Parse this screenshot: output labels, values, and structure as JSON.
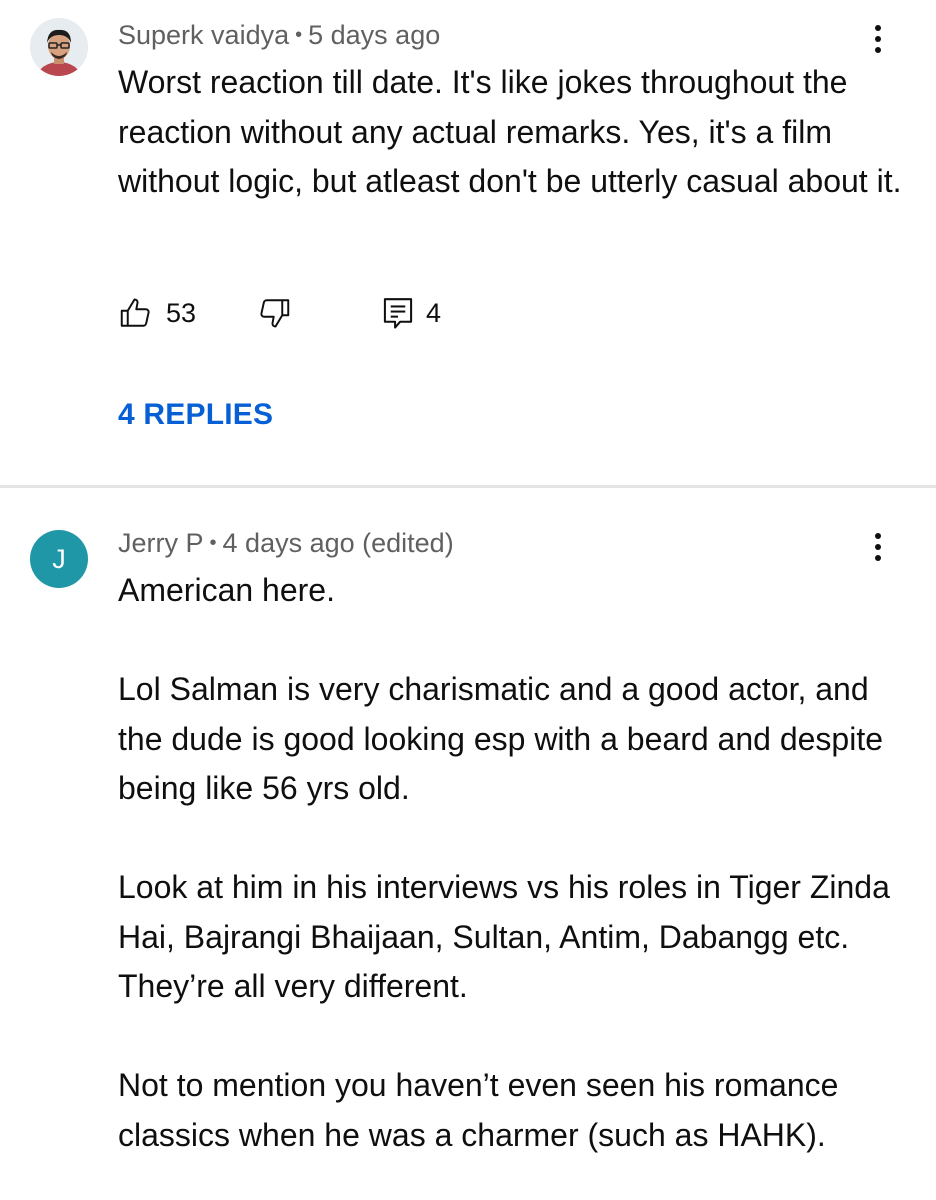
{
  "comments": [
    {
      "author": "Superk vaidya",
      "separator": "•",
      "time": "5 days ago",
      "avatar": "person-photo-avatar",
      "text": [
        "Worst reaction till date. It's like jokes throughout the reaction without any actual remarks. Yes, it's a film without logic, but atleast don't be utterly casual about it."
      ],
      "likes": "53",
      "reply_count": "4",
      "replies_label": "4 REPLIES"
    },
    {
      "author": "Jerry P",
      "separator": "•",
      "time": "4 days ago (edited)",
      "avatar_letter": "J",
      "avatar_color": "#1f97a6",
      "text": [
        "American here.",
        "Lol Salman is very charismatic and a good actor, and the dude is good looking esp with a beard and despite being like 56 yrs old.",
        "Look at him in his interviews vs his roles in Tiger Zinda Hai, Bajrangi Bhaijaan, Sultan, Antim, Dabangg etc. They’re all very different.",
        "Not to mention you haven’t even seen his romance classics when he was a charmer (such as HAHK)."
      ]
    }
  ],
  "colors": {
    "link_blue": "#065fd4",
    "meta_gray": "#606060",
    "divider": "#e5e5e5"
  },
  "icons": [
    "like-icon",
    "dislike-icon",
    "comment-icon",
    "more-options-icon"
  ]
}
